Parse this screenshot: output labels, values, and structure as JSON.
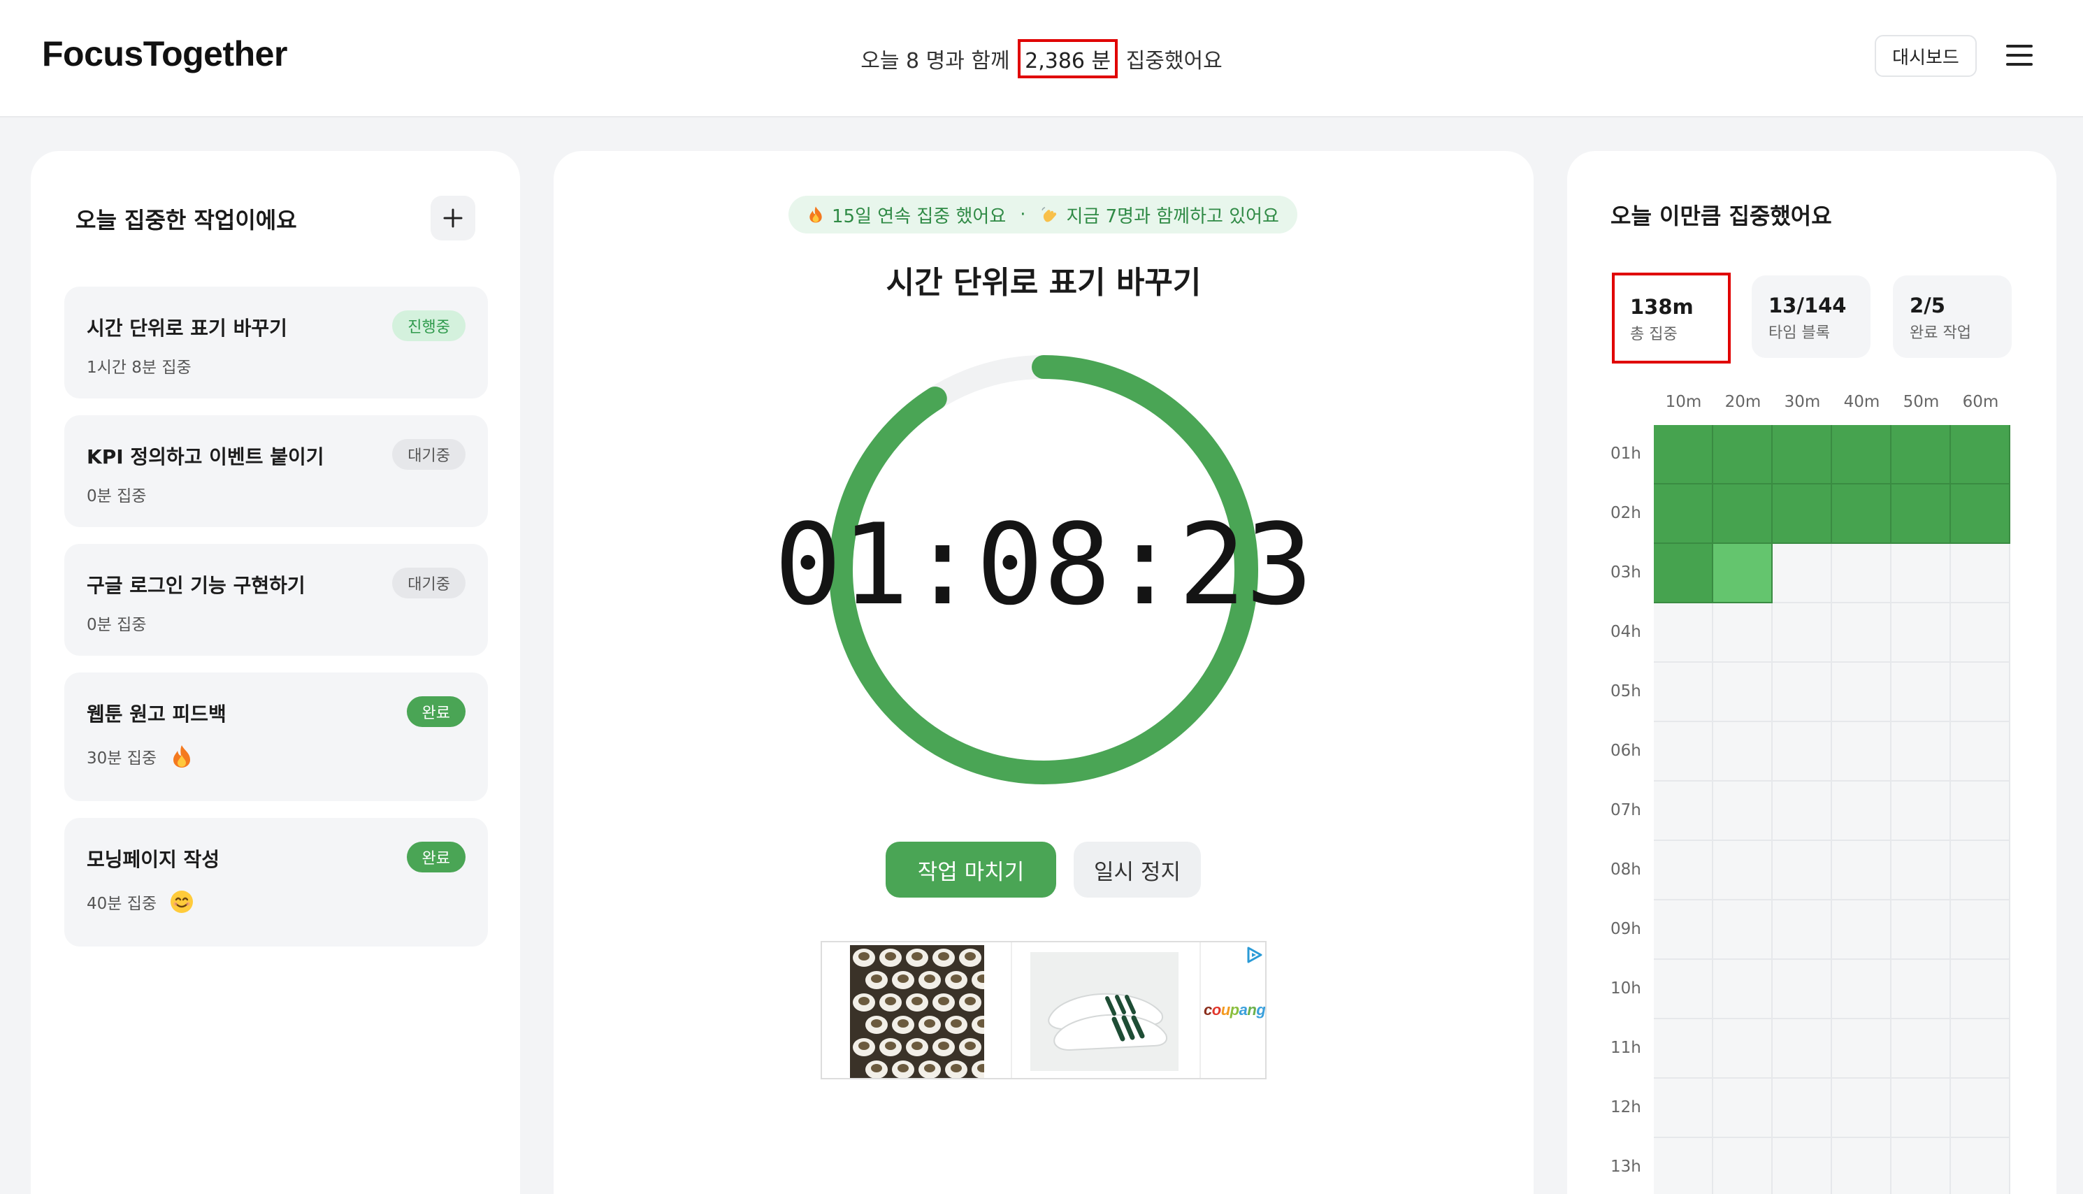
{
  "header": {
    "logo": "FocusTogether",
    "summary_prefix": "오늘 8 명과 함께",
    "summary_highlight": "2,386 분",
    "summary_suffix": "집중했어요",
    "dashboard_label": "대시보드"
  },
  "tasks_panel": {
    "title": "오늘 집중한 작업이에요",
    "tasks": [
      {
        "name": "시간 단위로 표기 바꾸기",
        "status": "진행중",
        "status_type": "progress",
        "time": "1시간 8분 집중",
        "emoji": ""
      },
      {
        "name": "KPI 정의하고 이벤트 붙이기",
        "status": "대기중",
        "status_type": "waiting",
        "time": "0분 집중",
        "emoji": ""
      },
      {
        "name": "구글 로그인 기능 구현하기",
        "status": "대기중",
        "status_type": "waiting",
        "time": "0분 집중",
        "emoji": ""
      },
      {
        "name": "웹툰 원고 피드백",
        "status": "완료",
        "status_type": "done",
        "time": "30분 집중",
        "emoji": "fire-icon"
      },
      {
        "name": "모닝페이지 작성",
        "status": "완료",
        "status_type": "done",
        "time": "40분 집중",
        "emoji": "smile-icon"
      }
    ]
  },
  "timer_panel": {
    "streak_text": "15일 연속 집중 했어요",
    "together_text": "지금 7명과 함께하고 있어요",
    "current_task": "시간 단위로 표기 바꾸기",
    "timer": "01:08:23",
    "progress_fraction": 0.91,
    "finish_label": "작업 마치기",
    "pause_label": "일시 정지",
    "ad_brand": "coupang"
  },
  "stats_panel": {
    "title": "오늘 이만큼 집중했어요",
    "stats": [
      {
        "value": "138m",
        "label": "총 집중"
      },
      {
        "value": "13/144",
        "label": "타임 블록"
      },
      {
        "value": "2/5",
        "label": "완료 작업"
      }
    ],
    "columns": [
      "10m",
      "20m",
      "30m",
      "40m",
      "50m",
      "60m"
    ],
    "rows": [
      "01h",
      "02h",
      "03h",
      "04h",
      "05h",
      "06h",
      "07h",
      "08h",
      "09h",
      "10h",
      "11h",
      "12h",
      "13h"
    ],
    "filled_blocks": [
      [
        1,
        1,
        1,
        1,
        1,
        1
      ],
      [
        1,
        1,
        1,
        1,
        1,
        1
      ],
      [
        1,
        0.5,
        0,
        0,
        0,
        0
      ],
      [
        0,
        0,
        0,
        0,
        0,
        0
      ],
      [
        0,
        0,
        0,
        0,
        0,
        0
      ],
      [
        0,
        0,
        0,
        0,
        0,
        0
      ],
      [
        0,
        0,
        0,
        0,
        0,
        0
      ],
      [
        0,
        0,
        0,
        0,
        0,
        0
      ],
      [
        0,
        0,
        0,
        0,
        0,
        0
      ],
      [
        0,
        0,
        0,
        0,
        0,
        0
      ],
      [
        0,
        0,
        0,
        0,
        0,
        0
      ],
      [
        0,
        0,
        0,
        0,
        0,
        0
      ],
      [
        0,
        0,
        0,
        0,
        0,
        0
      ]
    ]
  },
  "colors": {
    "accent": "#4aa555",
    "accent_light": "#64c56e",
    "highlight_box": "#e00000"
  }
}
